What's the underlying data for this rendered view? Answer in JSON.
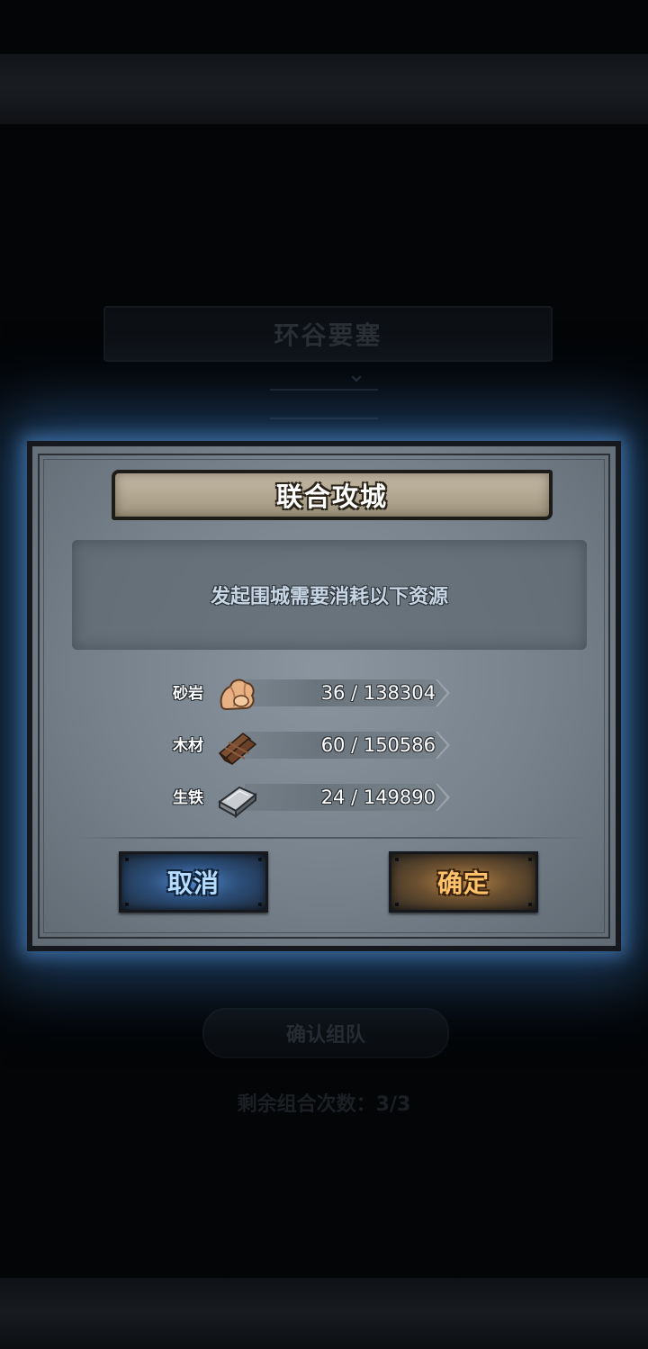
{
  "background": {
    "title": "环谷要塞",
    "pill_label": "确认组队",
    "note": "剩余组合次数：3/3"
  },
  "dialog": {
    "title": "联合攻城",
    "message": "发起围城需要消耗以下资源",
    "resources": [
      {
        "label": "砂岩",
        "value": "36 / 138304",
        "icon": "sandstone-icon"
      },
      {
        "label": "木材",
        "value": "60 / 150586",
        "icon": "wood-icon"
      },
      {
        "label": "生铁",
        "value": "24 / 149890",
        "icon": "iron-icon"
      }
    ],
    "cancel_label": "取消",
    "confirm_label": "确定"
  },
  "colors": {
    "glow": "#3c78be",
    "cancel_accent": "#4f84c8",
    "confirm_accent": "#ffc26a"
  }
}
